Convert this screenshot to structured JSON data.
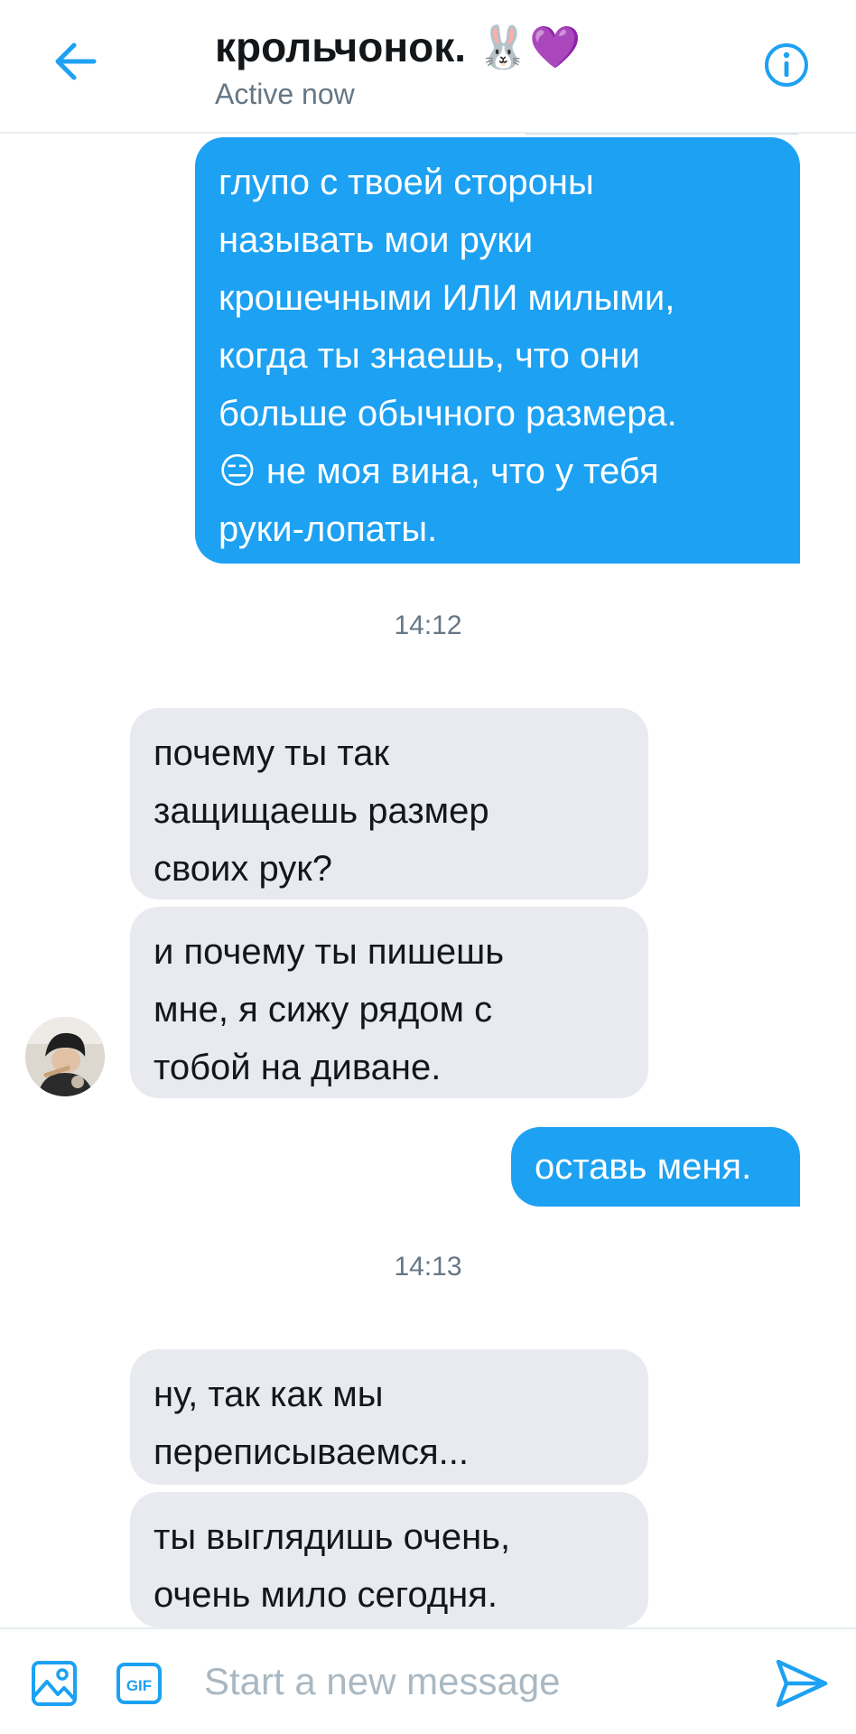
{
  "header": {
    "title": "крольчонок. 🐰💜",
    "status": "Active now"
  },
  "messages": {
    "m1": {
      "lines": [
        "глупо с твоей стороны",
        "называть мои руки",
        "крошечными ИЛИ милыми,",
        "когда ты знаешь, что они",
        "больше обычного размера.",
        "😑 не моя вина, что у тебя",
        "руки-лопаты."
      ]
    },
    "ts1": "14:12",
    "m2": {
      "lines": [
        "почему ты так",
        "защищаешь размер",
        "своих рук?"
      ]
    },
    "m3": {
      "lines": [
        "и почему ты пишешь",
        "мне, я сижу рядом с",
        "тобой на диване."
      ]
    },
    "m4": {
      "lines": [
        "оставь меня."
      ]
    },
    "ts2": "14:13",
    "m5": {
      "lines": [
        "ну, так как мы",
        "переписываемся..."
      ]
    },
    "m6": {
      "lines": [
        "ты выглядишь очень,",
        "очень мило сегодня."
      ]
    }
  },
  "composer": {
    "placeholder": "Start a new message",
    "gif_label": "GIF"
  },
  "icons": {
    "back": "arrow-left-icon",
    "info": "info-icon",
    "image": "image-icon",
    "gif": "gif-icon",
    "send": "send-icon"
  },
  "colors": {
    "accent": "#1da1f2",
    "incoming_bubble": "#e8eaf0",
    "secondary_text": "#657786",
    "placeholder": "#aab8c2"
  }
}
